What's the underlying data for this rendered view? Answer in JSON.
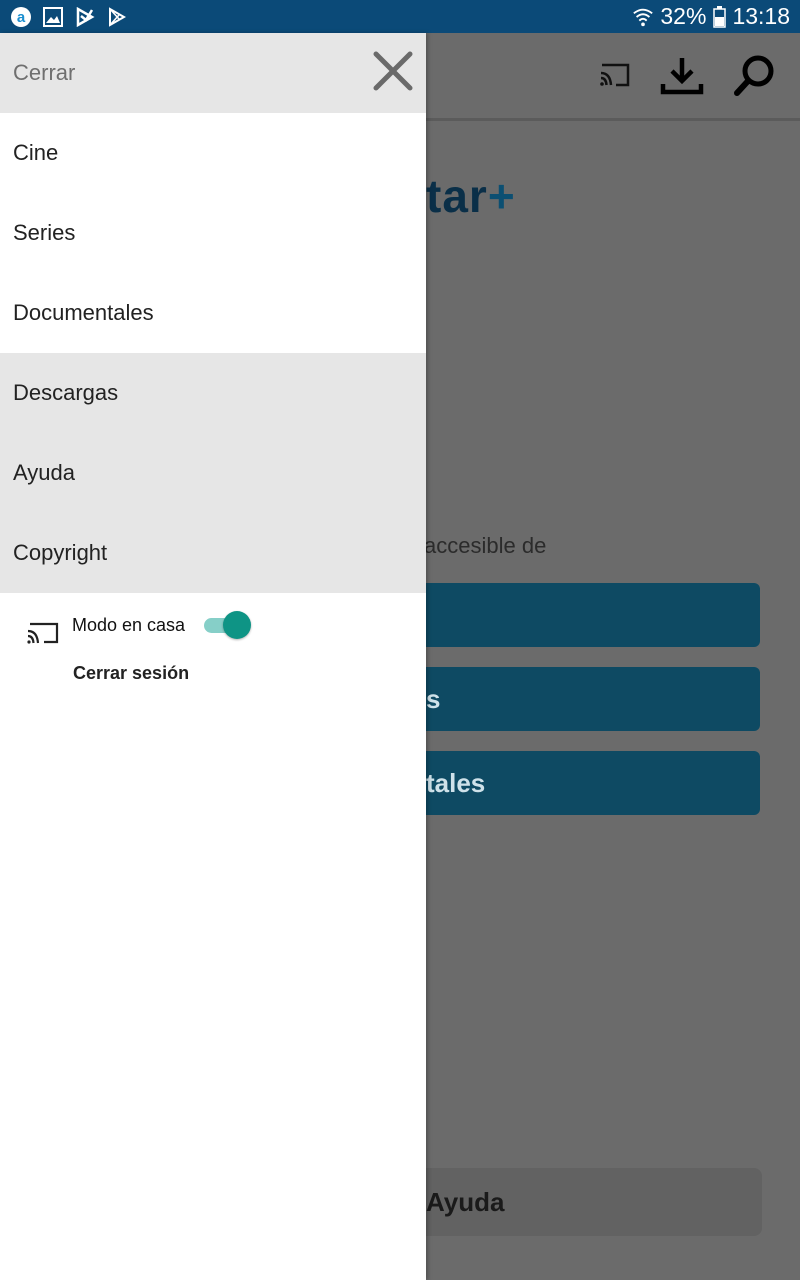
{
  "status_bar": {
    "battery": "32%",
    "time": "13:18",
    "icons": [
      "amazon-app-icon",
      "gallery-icon",
      "klarna-icon",
      "play-store-icon",
      "wifi-icon",
      "battery-icon"
    ]
  },
  "drawer": {
    "close_label": "Cerrar",
    "items": [
      {
        "label": "Cine"
      },
      {
        "label": "Series"
      },
      {
        "label": "Documentales"
      },
      {
        "label": "Descargas"
      },
      {
        "label": "Ayuda"
      },
      {
        "label": "Copyright"
      }
    ],
    "home_mode_label": "Modo en casa",
    "home_mode_on": true,
    "logout_label": "Cerrar sesión"
  },
  "background": {
    "logo_text": "tar",
    "logo_plus": "+",
    "partial_text": "accesible de",
    "buttons": [
      "",
      "s",
      "tales"
    ],
    "help_button": "Ayuda"
  },
  "colors": {
    "status_bar": "#0b4a78",
    "accent_toggle": "#0e9485",
    "drawer_highlight": "#e6e6e6"
  }
}
